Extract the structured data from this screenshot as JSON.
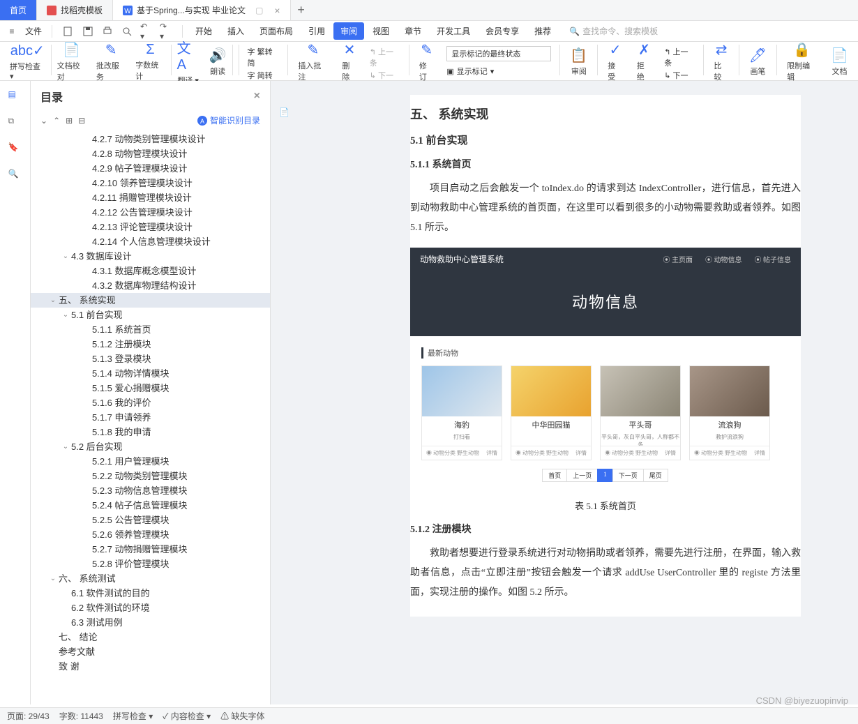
{
  "tabs": {
    "home": "首页",
    "t1": "找稻壳模板",
    "t2": "基于Spring...与实现 毕业论文"
  },
  "menubar": {
    "file": "文件",
    "items": [
      "开始",
      "插入",
      "页面布局",
      "引用",
      "审阅",
      "视图",
      "章节",
      "开发工具",
      "会员专享",
      "推荐"
    ],
    "active_index": 4,
    "search_placeholder": "查找命令、搜索模板"
  },
  "ribbon": {
    "groups": [
      "拼写检查",
      "文档校对",
      "批改服务",
      "字数统计",
      "翻译",
      "朗读"
    ],
    "zh_s2t": "繁转简",
    "zh_t2s": "简转繁",
    "insert_comment": "插入批注",
    "delete": "删除",
    "prev_comment": "上一条",
    "next_comment": "下一条",
    "revise": "修订",
    "track_combo": "显示标记的最终状态",
    "show_marks": "显示标记",
    "review": "审阅",
    "accept": "接受",
    "reject": "拒绝",
    "prev_rev": "上一条",
    "next_rev": "下一条",
    "compare": "比较",
    "pen": "画笔",
    "restrict": "限制编辑",
    "doc_label": "文档"
  },
  "outline": {
    "title": "目录",
    "ai": "智能识别目录",
    "items": [
      {
        "level": 3,
        "text": "4.2.7 动物类别管理模块设计"
      },
      {
        "level": 3,
        "text": "4.2.8 动物管理模块设计"
      },
      {
        "level": 3,
        "text": "4.2.9 帖子管理模块设计"
      },
      {
        "level": 3,
        "text": "4.2.10 领养管理模块设计"
      },
      {
        "level": 3,
        "text": "4.2.11 捐赠管理模块设计"
      },
      {
        "level": 3,
        "text": "4.2.12 公告管理模块设计"
      },
      {
        "level": 3,
        "text": "4.2.13 评论管理模块设计"
      },
      {
        "level": 3,
        "text": "4.2.14 个人信息管理模块设计"
      },
      {
        "level": 2,
        "text": "4.3 数据库设计",
        "chev": "v"
      },
      {
        "level": 3,
        "text": "4.3.1 数据库概念模型设计"
      },
      {
        "level": 3,
        "text": "4.3.2 数据库物理结构设计"
      },
      {
        "level": 1,
        "text": "五、 系统实现",
        "chev": "v",
        "current": true
      },
      {
        "level": 2,
        "text": "5.1 前台实现",
        "chev": "v"
      },
      {
        "level": 3,
        "text": "5.1.1 系统首页"
      },
      {
        "level": 3,
        "text": "5.1.2 注册模块"
      },
      {
        "level": 3,
        "text": "5.1.3 登录模块"
      },
      {
        "level": 3,
        "text": "5.1.4 动物详情模块"
      },
      {
        "level": 3,
        "text": "5.1.5 爱心捐赠模块"
      },
      {
        "level": 3,
        "text": "5.1.6 我的评价"
      },
      {
        "level": 3,
        "text": "5.1.7 申请领养"
      },
      {
        "level": 3,
        "text": "5.1.8 我的申请"
      },
      {
        "level": 2,
        "text": "5.2 后台实现",
        "chev": "v"
      },
      {
        "level": 3,
        "text": "5.2.1 用户管理模块"
      },
      {
        "level": 3,
        "text": "5.2.2 动物类别管理模块"
      },
      {
        "level": 3,
        "text": "5.2.3 动物信息管理模块"
      },
      {
        "level": 3,
        "text": "5.2.4 帖子信息管理模块"
      },
      {
        "level": 3,
        "text": "5.2.5 公告管理模块"
      },
      {
        "level": 3,
        "text": "5.2.6 领养管理模块"
      },
      {
        "level": 3,
        "text": "5.2.7 动物捐赠管理模块"
      },
      {
        "level": 3,
        "text": "5.2.8 评价管理模块"
      },
      {
        "level": 1,
        "text": "六、 系统测试",
        "chev": "v"
      },
      {
        "level": 2,
        "text": "6.1 软件测试的目的"
      },
      {
        "level": 2,
        "text": "6.2 软件测试的环境"
      },
      {
        "level": 2,
        "text": "6.3 测试用例"
      },
      {
        "level": 1,
        "text": "七、 结论"
      },
      {
        "level": 1,
        "text": "参考文献"
      },
      {
        "level": 1,
        "text": "致  谢"
      }
    ]
  },
  "doc": {
    "h2": "五、 系统实现",
    "h3_1": "5.1 前台实现",
    "h4_1": "5.1.1 系统首页",
    "p1": "项目启动之后会触发一个 toIndex.do 的请求到达 IndexController，进行信息，首先进入到动物救助中心管理系统的首页面，在这里可以看到很多的小动物需要救助或者领养。如图 5.1 所示。",
    "fig_brand": "动物救助中心管理系统",
    "fig_nav": [
      "主页面",
      "动物信息",
      "帖子信息"
    ],
    "fig_hero": "动物信息",
    "fig_section": "最新动物",
    "cards": [
      {
        "title": "海豹",
        "sub": "打扫看"
      },
      {
        "title": "中华田园猫",
        "sub": ""
      },
      {
        "title": "平头哥",
        "sub": "平头哥，灰白平头哥，人称都不多"
      },
      {
        "title": "流浪狗",
        "sub": "救护流浪狗"
      }
    ],
    "card_tag": "动物分类",
    "card_cat": "野生动物",
    "card_more": "详情",
    "pagi": [
      "首页",
      "上一页",
      "1",
      "下一页",
      "尾页"
    ],
    "fig_caption": "表 5.1 系统首页",
    "h4_2": "5.1.2 注册模块",
    "p2": "救助者想要进行登录系统进行对动物捐助或者领养，需要先进行注册，在界面，输入救助者信息，点击“立即注册”按钮会触发一个请求 addUse UserController 里的 registe 方法里面，实现注册的操作。如图 5.2 所示。"
  },
  "status": {
    "page": "页面: 29/43",
    "words": "字数: 11443",
    "spell": "拼写检查",
    "content": "内容检查",
    "font_missing": "缺失字体"
  },
  "watermark": "CSDN @biyezuopinvip"
}
